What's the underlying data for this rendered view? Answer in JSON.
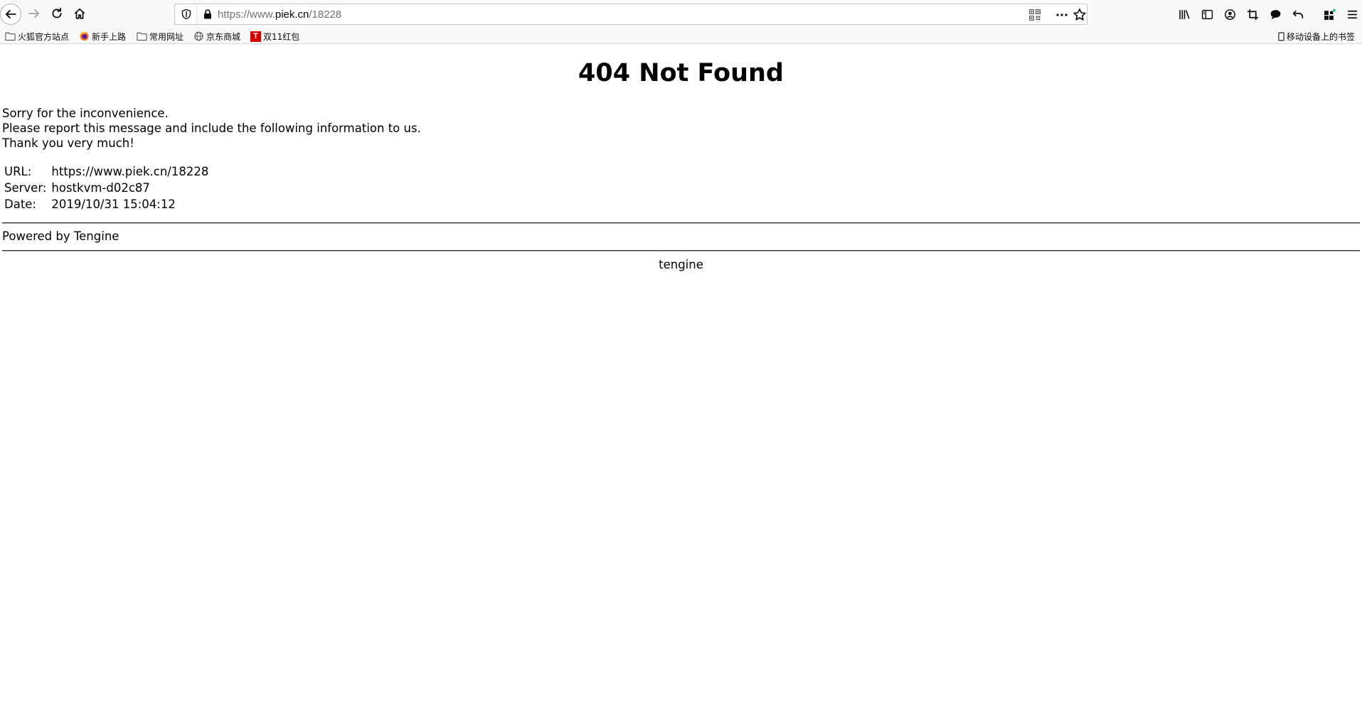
{
  "browser": {
    "url_prefix": "https://www.",
    "url_host": "piek.cn",
    "url_path": "/18228",
    "bookmarks": [
      {
        "label": "火狐官方站点",
        "icon": "folder-icon"
      },
      {
        "label": "新手上路",
        "icon": "firefox-icon"
      },
      {
        "label": "常用网址",
        "icon": "folder-icon"
      },
      {
        "label": "京东商城",
        "icon": "globe-icon"
      },
      {
        "label": "双11红包",
        "icon": "tmall-icon"
      }
    ],
    "mobile_bookmarks": "移动设备上的书签",
    "tmall_glyph": "T"
  },
  "page": {
    "title": "404 Not Found",
    "messages": [
      "Sorry for the inconvenience.",
      "Please report this message and include the following information to us.",
      "Thank you very much!"
    ],
    "info": [
      {
        "key": "URL:",
        "value": "https://www.piek.cn/18228"
      },
      {
        "key": "Server:",
        "value": "hostkvm-d02c87"
      },
      {
        "key": "Date:",
        "value": "2019/10/31 15:04:12"
      }
    ],
    "powered_by": "Powered by Tengine",
    "footer": "tengine"
  }
}
